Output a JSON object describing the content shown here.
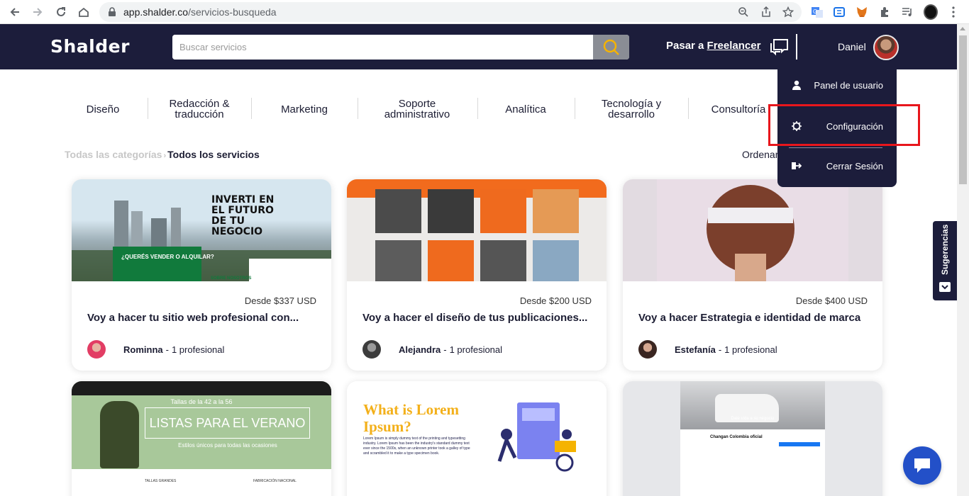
{
  "browser": {
    "url_host": "app.shalder.co",
    "url_path": "/servicios-busqueda"
  },
  "header": {
    "logo": "Shalder",
    "search_placeholder": "Buscar servicios",
    "switch_prefix": "Pasar a ",
    "switch_link": "Freelancer",
    "user_name": "Daniel"
  },
  "categories": [
    "Diseño",
    "Redacción & traducción",
    "Marketing",
    "Soporte administrativo",
    "Analítica",
    "Tecnología y desarrollo",
    "Consultoría"
  ],
  "breadcrumb": {
    "parent": "Todas las categorías",
    "current": "Todos los servicios"
  },
  "sort_label": "Ordenar",
  "cards": [
    {
      "price": "Desde $337 USD",
      "title": "Voy a hacer tu sitio web profesional con...",
      "seller": "Rominna",
      "professionals": "1 profesional",
      "img_text1": "INVERTI EN EL FUTURO DE TU NEGOCIO",
      "img_text2": "¿QUERÉS VENDER O ALQUILAR?",
      "img_text3": "SOBRE NOSOTROS"
    },
    {
      "price": "Desde $200 USD",
      "title": "Voy a hacer el diseño de tus publicaciones...",
      "seller": "Alejandra",
      "professionals": "1 profesional"
    },
    {
      "price": "Desde $400 USD",
      "title": "Voy a hacer Estrategia e identidad de marca",
      "seller": "Estefanía",
      "professionals": "1 profesional"
    },
    {
      "img_text1": "Tallas de la 42 a la 56",
      "img_text2": "LISTAS PARA EL VERANO",
      "img_text3": "Estilos únicos para todas las ocasiones",
      "img_text4": "TALLAS GRANDES",
      "img_text5": "FABRICACIÓN NACIONAL"
    },
    {
      "img_text1": "What is Lorem Ipsum?",
      "img_text2": "Lorem Ipsum is simply dummy text of the printing and typesetting industry. Lorem Ipsum has been the industry's standard dummy text ever since the 1500s, when an unknown printer took a galley of type and scrambled it to make a type specimen book."
    },
    {
      "img_text1": "Dale vida a su negocio",
      "img_text2": "Changan Colombia oficial"
    }
  ],
  "user_menu": {
    "items": [
      "Panel de usuario",
      "Configuración",
      "Cerrar Sesión"
    ]
  },
  "suggestions_tab": "Sugerencias",
  "colors": {
    "navy": "#1c1d3b",
    "accent_yellow": "#f5b301",
    "highlight_red": "#e8161c",
    "chat_blue": "#2350c8"
  }
}
